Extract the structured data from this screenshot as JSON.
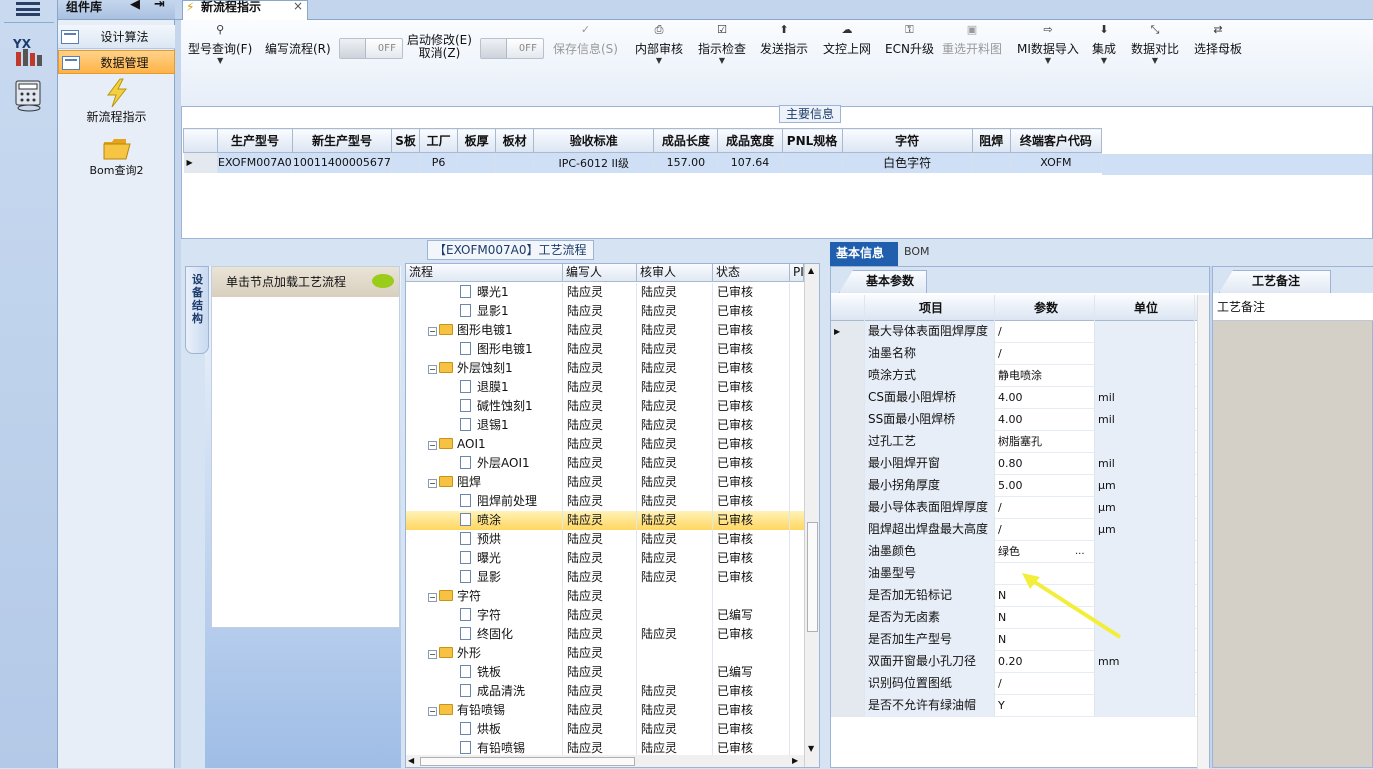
{
  "sidebar_rail": {
    "items": [
      "yx-app-icon",
      "calculator-icon"
    ]
  },
  "component_panel": {
    "title": "组件库",
    "nav": [
      {
        "label": "设计算法"
      },
      {
        "label": "数据管理"
      }
    ],
    "items": [
      {
        "label": "新流程指示"
      },
      {
        "label": "Bom查询2"
      }
    ]
  },
  "tabs": [
    {
      "label": "新流程指示"
    }
  ],
  "toolbar": {
    "items": [
      {
        "label": "型号查询(F)",
        "icon": "search-icon",
        "dropdown": true
      },
      {
        "label": "编写流程(R)",
        "toggle": "OFF"
      },
      {
        "label_line1": "启动修改(E)",
        "label_line2": "取消(Z)",
        "toggle": "OFF"
      },
      {
        "label": "保存信息(S)",
        "icon": "check-icon",
        "disabled": true
      },
      {
        "label": "内部审核",
        "icon": "printer-icon",
        "dropdown": true
      },
      {
        "label": "指示检查",
        "icon": "checkbox-icon",
        "dropdown": true
      },
      {
        "label": "发送指示",
        "icon": "upload-icon"
      },
      {
        "label": "文控上网",
        "icon": "cloud-upload-icon"
      },
      {
        "label": "ECN升级",
        "icon": "binoculars-icon"
      },
      {
        "label": "重选开料图",
        "icon": "image-icon",
        "disabled": true
      },
      {
        "label": "MI数据导入",
        "icon": "import-icon",
        "dropdown": true
      },
      {
        "label": "集成",
        "icon": "download-icon",
        "dropdown": true
      },
      {
        "label": "数据对比",
        "icon": "compare-icon",
        "dropdown": true
      },
      {
        "label": "选择母板",
        "icon": "shuffle-icon"
      }
    ]
  },
  "main_info": {
    "title": "主要信息",
    "columns": [
      "生产型号",
      "新生产型号",
      "S板",
      "工厂",
      "板厚",
      "板材",
      "验收标准",
      "成品长度",
      "成品宽度",
      "PNL规格",
      "字符",
      "阻焊",
      "终端客户代码"
    ],
    "rows": [
      [
        "EXOFM007A0",
        "10011400005677",
        "",
        "P6",
        "",
        "",
        "IPC-6012 II级",
        "157.00",
        "107.64",
        "",
        "白色字符",
        "",
        "XOFM"
      ]
    ]
  },
  "flow": {
    "title": "【EXOFM007A0】工艺流程",
    "side_tab": "设备结构",
    "node_hint": "单击节点加载工艺流程",
    "columns": [
      "流程",
      "编写人",
      "核审人",
      "状态",
      "PI"
    ],
    "rows": [
      {
        "level": 2,
        "type": "doc",
        "name": "曝光1",
        "writer": "陆应灵",
        "reviewer": "陆应灵",
        "status": "已审核"
      },
      {
        "level": 2,
        "type": "doc",
        "name": "显影1",
        "writer": "陆应灵",
        "reviewer": "陆应灵",
        "status": "已审核"
      },
      {
        "level": 1,
        "type": "folder",
        "name": "图形电镀1",
        "writer": "陆应灵",
        "reviewer": "陆应灵",
        "status": "已审核"
      },
      {
        "level": 2,
        "type": "doc",
        "name": "图形电镀1",
        "writer": "陆应灵",
        "reviewer": "陆应灵",
        "status": "已审核"
      },
      {
        "level": 1,
        "type": "folder",
        "name": "外层蚀刻1",
        "writer": "陆应灵",
        "reviewer": "陆应灵",
        "status": "已审核"
      },
      {
        "level": 2,
        "type": "doc",
        "name": "退膜1",
        "writer": "陆应灵",
        "reviewer": "陆应灵",
        "status": "已审核"
      },
      {
        "level": 2,
        "type": "doc",
        "name": "碱性蚀刻1",
        "writer": "陆应灵",
        "reviewer": "陆应灵",
        "status": "已审核"
      },
      {
        "level": 2,
        "type": "doc",
        "name": "退锡1",
        "writer": "陆应灵",
        "reviewer": "陆应灵",
        "status": "已审核"
      },
      {
        "level": 1,
        "type": "folder",
        "name": "AOI1",
        "writer": "陆应灵",
        "reviewer": "陆应灵",
        "status": "已审核"
      },
      {
        "level": 2,
        "type": "doc",
        "name": "外层AOI1",
        "writer": "陆应灵",
        "reviewer": "陆应灵",
        "status": "已审核"
      },
      {
        "level": 1,
        "type": "folder",
        "name": "阻焊",
        "writer": "陆应灵",
        "reviewer": "陆应灵",
        "status": "已审核"
      },
      {
        "level": 2,
        "type": "doc",
        "name": "阻焊前处理",
        "writer": "陆应灵",
        "reviewer": "陆应灵",
        "status": "已审核"
      },
      {
        "level": 2,
        "type": "doc",
        "name": "喷涂",
        "writer": "陆应灵",
        "reviewer": "陆应灵",
        "status": "已审核",
        "selected": true
      },
      {
        "level": 2,
        "type": "doc",
        "name": "预烘",
        "writer": "陆应灵",
        "reviewer": "陆应灵",
        "status": "已审核"
      },
      {
        "level": 2,
        "type": "doc",
        "name": "曝光",
        "writer": "陆应灵",
        "reviewer": "陆应灵",
        "status": "已审核"
      },
      {
        "level": 2,
        "type": "doc",
        "name": "显影",
        "writer": "陆应灵",
        "reviewer": "陆应灵",
        "status": "已审核"
      },
      {
        "level": 1,
        "type": "folder",
        "name": "字符",
        "writer": "陆应灵",
        "reviewer": "",
        "status": ""
      },
      {
        "level": 2,
        "type": "doc",
        "name": "字符",
        "writer": "陆应灵",
        "reviewer": "",
        "status": "已编写"
      },
      {
        "level": 2,
        "type": "doc",
        "name": "终固化",
        "writer": "陆应灵",
        "reviewer": "陆应灵",
        "status": "已审核"
      },
      {
        "level": 1,
        "type": "folder",
        "name": "外形",
        "writer": "陆应灵",
        "reviewer": "",
        "status": ""
      },
      {
        "level": 2,
        "type": "doc",
        "name": "铣板",
        "writer": "陆应灵",
        "reviewer": "",
        "status": "已编写"
      },
      {
        "level": 2,
        "type": "doc",
        "name": "成品清洗",
        "writer": "陆应灵",
        "reviewer": "陆应灵",
        "status": "已审核"
      },
      {
        "level": 1,
        "type": "folder",
        "name": "有铅喷锡",
        "writer": "陆应灵",
        "reviewer": "陆应灵",
        "status": "已审核"
      },
      {
        "level": 2,
        "type": "doc",
        "name": "烘板",
        "writer": "陆应灵",
        "reviewer": "陆应灵",
        "status": "已审核"
      },
      {
        "level": 2,
        "type": "doc",
        "name": "有铅喷锡",
        "writer": "陆应灵",
        "reviewer": "陆应灵",
        "status": "已审核"
      }
    ]
  },
  "basic_info": {
    "tabs": [
      "基本信息",
      "BOM"
    ],
    "group_tab": "基本参数",
    "columns": [
      "项目",
      "参数",
      "单位"
    ],
    "rows": [
      [
        "最大导体表面阻焊厚度",
        "/",
        ""
      ],
      [
        "油墨名称",
        "/",
        ""
      ],
      [
        "喷涂方式",
        "静电喷涂",
        ""
      ],
      [
        "CS面最小阻焊桥",
        "4.00",
        "mil"
      ],
      [
        "SS面最小阻焊桥",
        "4.00",
        "mil"
      ],
      [
        "过孔工艺",
        "树脂塞孔",
        ""
      ],
      [
        "最小阻焊开窗",
        "0.80",
        "mil"
      ],
      [
        "最小拐角厚度",
        "5.00",
        "μm"
      ],
      [
        "最小导体表面阻焊厚度",
        "/",
        "μm"
      ],
      [
        "阻焊超出焊盘最大高度",
        "/",
        "μm"
      ],
      [
        "油墨颜色",
        "绿色",
        ""
      ],
      [
        "油墨型号",
        "",
        ""
      ],
      [
        "是否加无铅标记",
        "N",
        ""
      ],
      [
        "是否为无卤素",
        "N",
        ""
      ],
      [
        "是否加生产型号",
        "N",
        ""
      ],
      [
        "双面开窗最小孔刀径",
        "0.20",
        "mm"
      ],
      [
        "识别码位置图纸",
        "/",
        ""
      ],
      [
        "是否不允许有绿油帽",
        "Y",
        ""
      ]
    ],
    "ellipsis": "..."
  },
  "notes": {
    "tab": "工艺备注",
    "column": "工艺备注"
  },
  "colors": {
    "selection": "#ffd660",
    "accent": "#1f5fae",
    "arrow": "#e6e63a"
  }
}
